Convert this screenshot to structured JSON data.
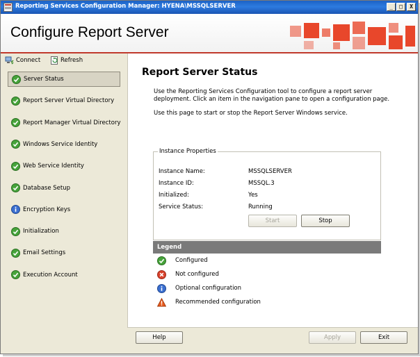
{
  "window": {
    "title": "Reporting Services Configuration Manager: HYENA\\MSSQLSERVER",
    "controls": {
      "minimize": "_",
      "maximize": "□",
      "close": "X"
    }
  },
  "header": {
    "heading": "Configure Report Server",
    "accent_color": "#e8472b"
  },
  "toolbar": {
    "connect_label": "Connect",
    "refresh_label": "Refresh"
  },
  "nav": {
    "items": [
      {
        "label": "Server Status",
        "icon": "check-icon",
        "selected": true
      },
      {
        "label": "Report Server Virtual Directory",
        "icon": "check-icon"
      },
      {
        "label": "Report Manager Virtual Directory",
        "icon": "check-icon"
      },
      {
        "label": "Windows Service Identity",
        "icon": "check-icon"
      },
      {
        "label": "Web Service Identity",
        "icon": "check-icon"
      },
      {
        "label": "Database Setup",
        "icon": "check-icon"
      },
      {
        "label": "Encryption Keys",
        "icon": "info-icon"
      },
      {
        "label": "Initialization",
        "icon": "check-icon"
      },
      {
        "label": "Email Settings",
        "icon": "check-icon"
      },
      {
        "label": "Execution Account",
        "icon": "check-icon"
      }
    ]
  },
  "main": {
    "title": "Report Server Status",
    "description": "Use the Reporting Services Configuration tool to configure a report server deployment. Click an item in the navigation pane to open a configuration page.",
    "instruction": "Use this page to start or stop the Report Server Windows service.",
    "instance_properties": {
      "group_label": "Instance Properties",
      "rows": [
        {
          "label": "Instance Name:",
          "value": "MSSQLSERVER"
        },
        {
          "label": "Instance ID:",
          "value": "MSSQL.3"
        },
        {
          "label": "Initialized:",
          "value": "Yes"
        },
        {
          "label": "Service Status:",
          "value": "Running"
        }
      ],
      "start_label": "Start",
      "stop_label": "Stop"
    },
    "legend": {
      "title": "Legend",
      "items": [
        {
          "label": "Configured",
          "icon": "check-icon"
        },
        {
          "label": "Not configured",
          "icon": "error-icon"
        },
        {
          "label": "Optional configuration",
          "icon": "info-icon"
        },
        {
          "label": "Recommended configuration",
          "icon": "warning-icon"
        }
      ]
    }
  },
  "footer": {
    "help_label": "Help",
    "apply_label": "Apply",
    "exit_label": "Exit"
  }
}
